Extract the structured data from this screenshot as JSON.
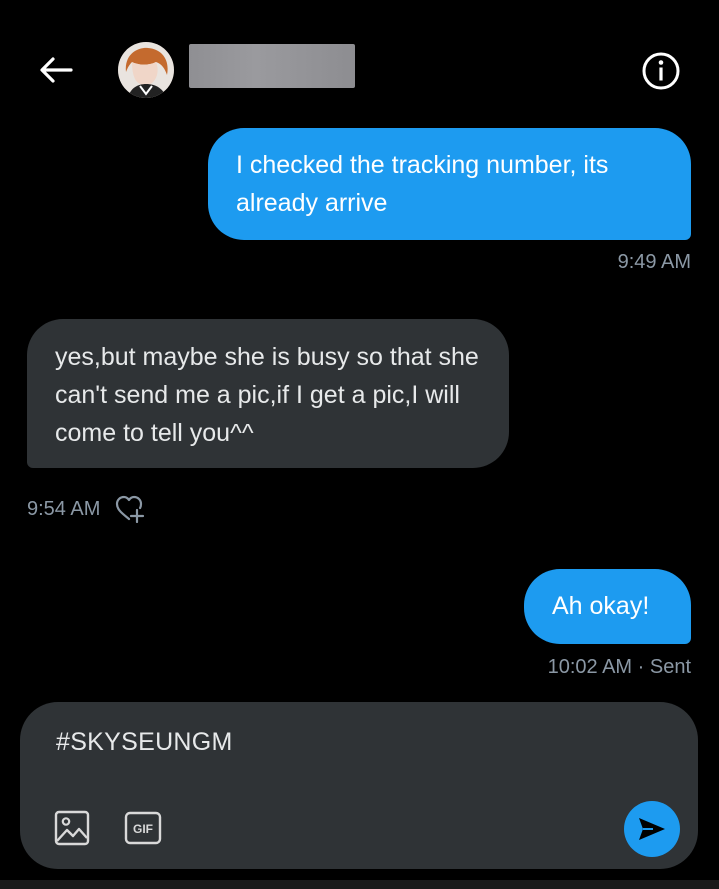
{
  "header": {
    "back_icon": "arrow-left-icon",
    "avatar_icon": "avatar",
    "info_icon": "info-circle-icon"
  },
  "messages": [
    {
      "direction": "sent",
      "text": "I checked the tracking number, its already arrive",
      "meta": "9:49 AM"
    },
    {
      "direction": "received",
      "text": "yes,but maybe she is busy so that she can't send me a pic,if I get a pic,I will come to tell you^^",
      "meta": "9:54 AM"
    },
    {
      "direction": "sent",
      "text": "Ah okay!",
      "meta": "10:02 AM · Sent"
    }
  ],
  "composer": {
    "value": "#SKYSEUNGM",
    "media_icon": "image-icon",
    "gif_label": "GIF",
    "send_icon": "send-icon"
  },
  "colors": {
    "accent": "#1d9bf0",
    "received_bubble": "#2f3336",
    "meta_text": "#8b98a5",
    "background": "#000000"
  }
}
